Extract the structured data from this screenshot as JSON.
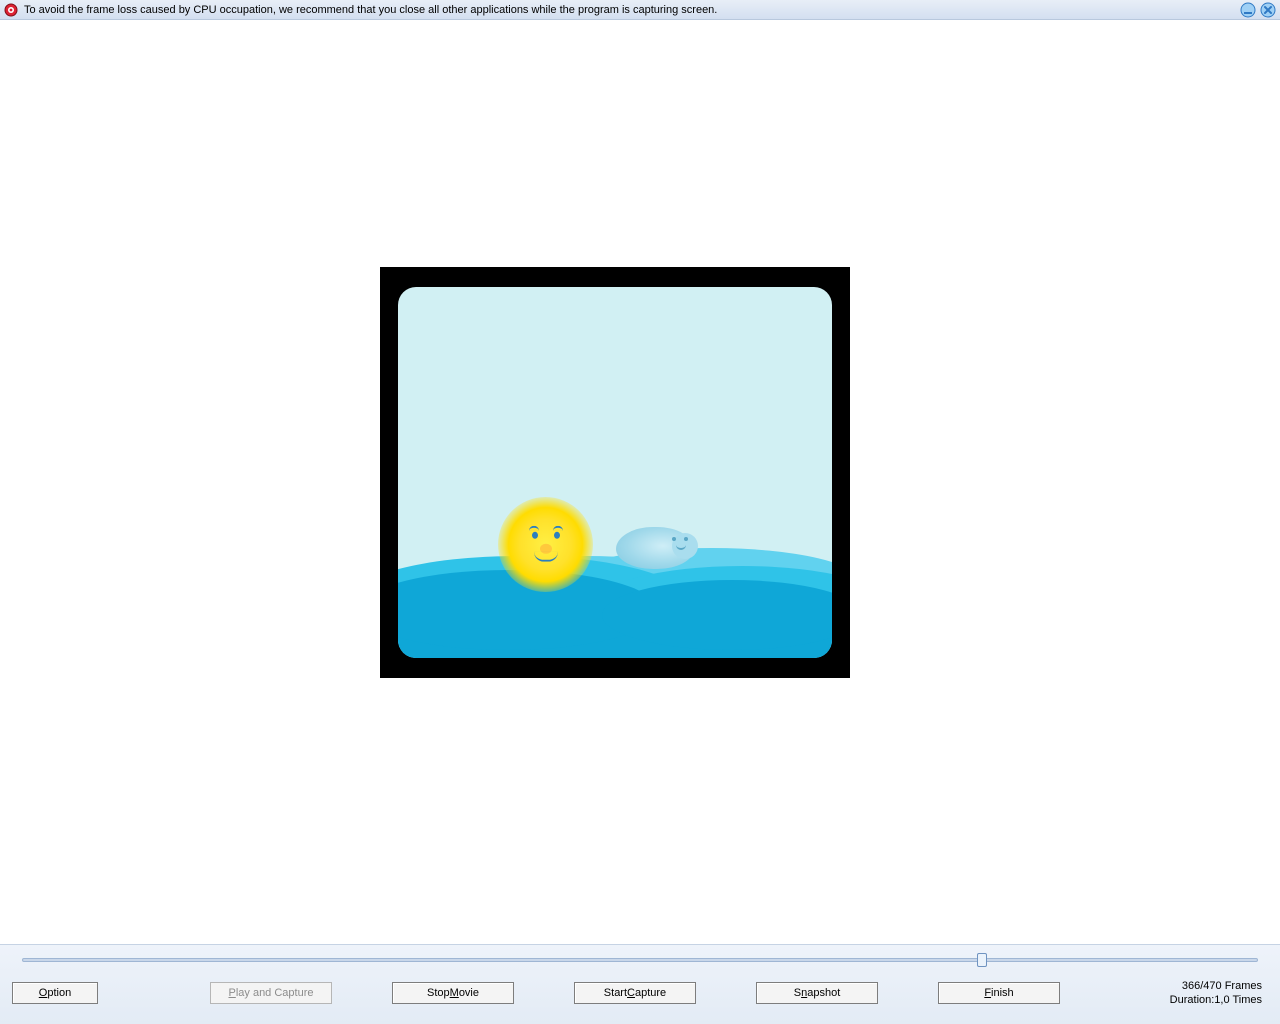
{
  "titlebar": {
    "text": "To avoid the frame loss caused by CPU occupation, we recommend that you close all other applications while the program is capturing screen.",
    "icon": "record-icon",
    "minimize_label": "Minimize",
    "close_label": "Close"
  },
  "buttons": {
    "option": {
      "full": "Option",
      "pre": "",
      "u": "O",
      "post": "ption"
    },
    "play": {
      "full": "Play and Capture",
      "pre": "",
      "u": "P",
      "post": "lay and Capture"
    },
    "stop": {
      "full": "Stop Movie",
      "pre": "Stop ",
      "u": "M",
      "post": "ovie"
    },
    "start": {
      "full": "Start Capture",
      "pre": "Start ",
      "u": "C",
      "post": "apture"
    },
    "snapshot": {
      "full": "Snapshot",
      "pre": "S",
      "u": "n",
      "post": "apshot"
    },
    "finish": {
      "full": "Finish",
      "pre": "",
      "u": "F",
      "post": "inish"
    }
  },
  "progress": {
    "current_frame": 366,
    "total_frames": 470,
    "percent": 77.87
  },
  "status": {
    "frames_line": "366/470 Frames",
    "duration_line": "Duration:1,0 Times"
  }
}
